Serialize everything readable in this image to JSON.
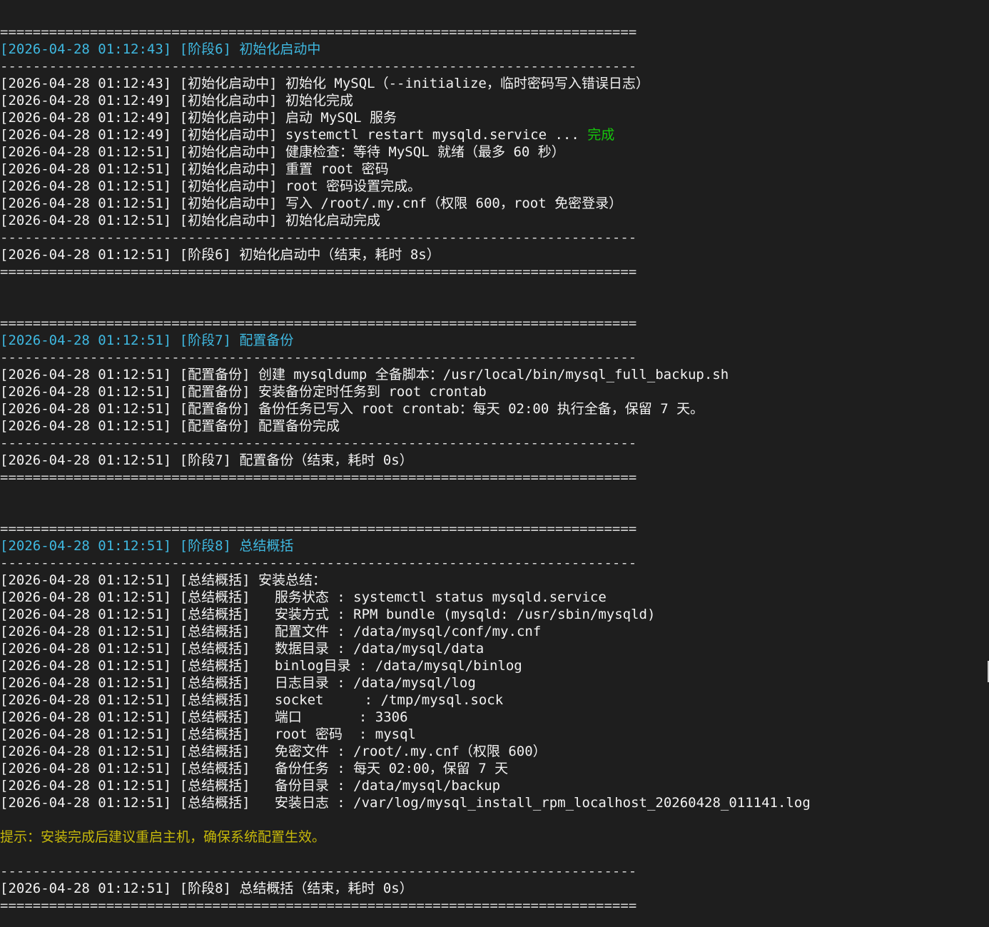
{
  "separators": {
    "double": "==============================================================================",
    "single": "------------------------------------------------------------------------------"
  },
  "colors": {
    "background": "#1e1e1e",
    "text": "#f2f2f2",
    "stage_header": "#3fb8e0",
    "success": "#16c60c",
    "tip": "#c6b80a"
  },
  "stage6": {
    "header": "[2026-04-28 01:12:43] [阶段6] 初始化启动中",
    "lines": [
      "[2026-04-28 01:12:43] [初始化启动中] 初始化 MySQL（--initialize，临时密码写入错误日志）",
      "[2026-04-28 01:12:49] [初始化启动中] 初始化完成",
      "[2026-04-28 01:12:49] [初始化启动中] 启动 MySQL 服务"
    ],
    "restart_line": "[2026-04-28 01:12:49] [初始化启动中] systemctl restart mysqld.service ... ",
    "restart_status": "完成",
    "lines_after": [
      "[2026-04-28 01:12:51] [初始化启动中] 健康检查：等待 MySQL 就绪（最多 60 秒）",
      "[2026-04-28 01:12:51] [初始化启动中] 重置 root 密码",
      "[2026-04-28 01:12:51] [初始化启动中] root 密码设置完成。",
      "[2026-04-28 01:12:51] [初始化启动中] 写入 /root/.my.cnf（权限 600，root 免密登录）",
      "[2026-04-28 01:12:51] [初始化启动中] 初始化启动完成"
    ],
    "footer": "[2026-04-28 01:12:51] [阶段6] 初始化启动中（结束，耗时 8s）"
  },
  "stage7": {
    "header": "[2026-04-28 01:12:51] [阶段7] 配置备份",
    "lines": [
      "[2026-04-28 01:12:51] [配置备份] 创建 mysqldump 全备脚本：/usr/local/bin/mysql_full_backup.sh",
      "[2026-04-28 01:12:51] [配置备份] 安装备份定时任务到 root crontab",
      "[2026-04-28 01:12:51] [配置备份] 备份任务已写入 root crontab：每天 02:00 执行全备，保留 7 天。",
      "[2026-04-28 01:12:51] [配置备份] 配置备份完成"
    ],
    "footer": "[2026-04-28 01:12:51] [阶段7] 配置备份（结束，耗时 0s）"
  },
  "stage8": {
    "header": "[2026-04-28 01:12:51] [阶段8] 总结概括",
    "lines": [
      "[2026-04-28 01:12:51] [总结概括] 安装总结：",
      "[2026-04-28 01:12:51] [总结概括]   服务状态 : systemctl status mysqld.service",
      "[2026-04-28 01:12:51] [总结概括]   安装方式 : RPM bundle (mysqld: /usr/sbin/mysqld)",
      "[2026-04-28 01:12:51] [总结概括]   配置文件 : /data/mysql/conf/my.cnf",
      "[2026-04-28 01:12:51] [总结概括]   数据目录 : /data/mysql/data",
      "[2026-04-28 01:12:51] [总结概括]   binlog目录 : /data/mysql/binlog",
      "[2026-04-28 01:12:51] [总结概括]   日志目录 : /data/mysql/log",
      "[2026-04-28 01:12:51] [总结概括]   socket     : /tmp/mysql.sock",
      "[2026-04-28 01:12:51] [总结概括]   端口       : 3306",
      "[2026-04-28 01:12:51] [总结概括]   root 密码  : mysql",
      "[2026-04-28 01:12:51] [总结概括]   免密文件 : /root/.my.cnf（权限 600）",
      "[2026-04-28 01:12:51] [总结概括]   备份任务 : 每天 02:00，保留 7 天",
      "[2026-04-28 01:12:51] [总结概括]   备份目录 : /data/mysql/backup",
      "[2026-04-28 01:12:51] [总结概括]   安装日志 : /var/log/mysql_install_rpm_localhost_20260428_011141.log"
    ],
    "tip": "提示：安装完成后建议重启主机，确保系统配置生效。",
    "footer": "[2026-04-28 01:12:51] [阶段8] 总结概括（结束，耗时 0s）"
  }
}
